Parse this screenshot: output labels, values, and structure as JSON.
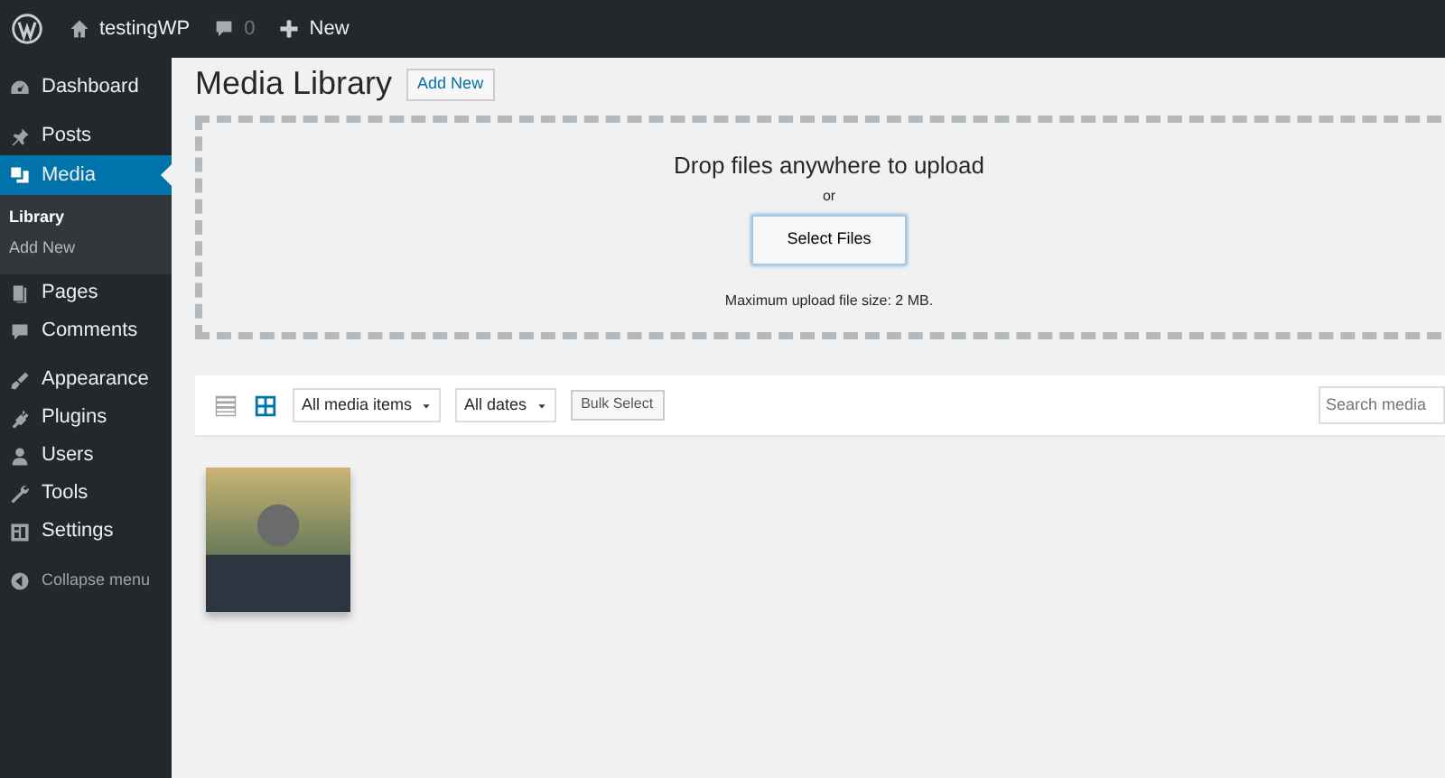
{
  "admin_bar": {
    "site_name": "testingWP",
    "comments_count": "0",
    "new_label": "New"
  },
  "sidebar": {
    "groups": [
      [
        {
          "label": "Dashboard",
          "kind": "dashboard",
          "selected": false
        }
      ],
      [
        {
          "label": "Posts",
          "kind": "pin",
          "selected": false
        },
        {
          "label": "Media",
          "kind": "media",
          "selected": true,
          "children": [
            {
              "label": "Library",
              "selected": true
            },
            {
              "label": "Add New",
              "selected": false
            }
          ]
        },
        {
          "label": "Pages",
          "kind": "pages",
          "selected": false
        },
        {
          "label": "Comments",
          "kind": "comment",
          "selected": false
        }
      ],
      [
        {
          "label": "Appearance",
          "kind": "brush",
          "selected": false
        },
        {
          "label": "Plugins",
          "kind": "plug",
          "selected": false
        },
        {
          "label": "Users",
          "kind": "user",
          "selected": false
        },
        {
          "label": "Tools",
          "kind": "wrench",
          "selected": false
        },
        {
          "label": "Settings",
          "kind": "settings",
          "selected": false
        }
      ]
    ],
    "collapse_label": "Collapse menu"
  },
  "page": {
    "title": "Media Library",
    "add_new": "Add New"
  },
  "uploader": {
    "heading": "Drop files anywhere to upload",
    "or": "or",
    "button": "Select Files",
    "max_size": "Maximum upload file size: 2 MB."
  },
  "toolbar": {
    "views": [
      {
        "kind": "list",
        "selected": false
      },
      {
        "kind": "grid",
        "selected": true
      }
    ],
    "filters": [
      "All media items",
      "All dates"
    ],
    "bulk_button": "Bulk Select",
    "search": {
      "placeholder": "Search media"
    }
  },
  "attachments": [
    {
      "kind": "photo"
    }
  ]
}
